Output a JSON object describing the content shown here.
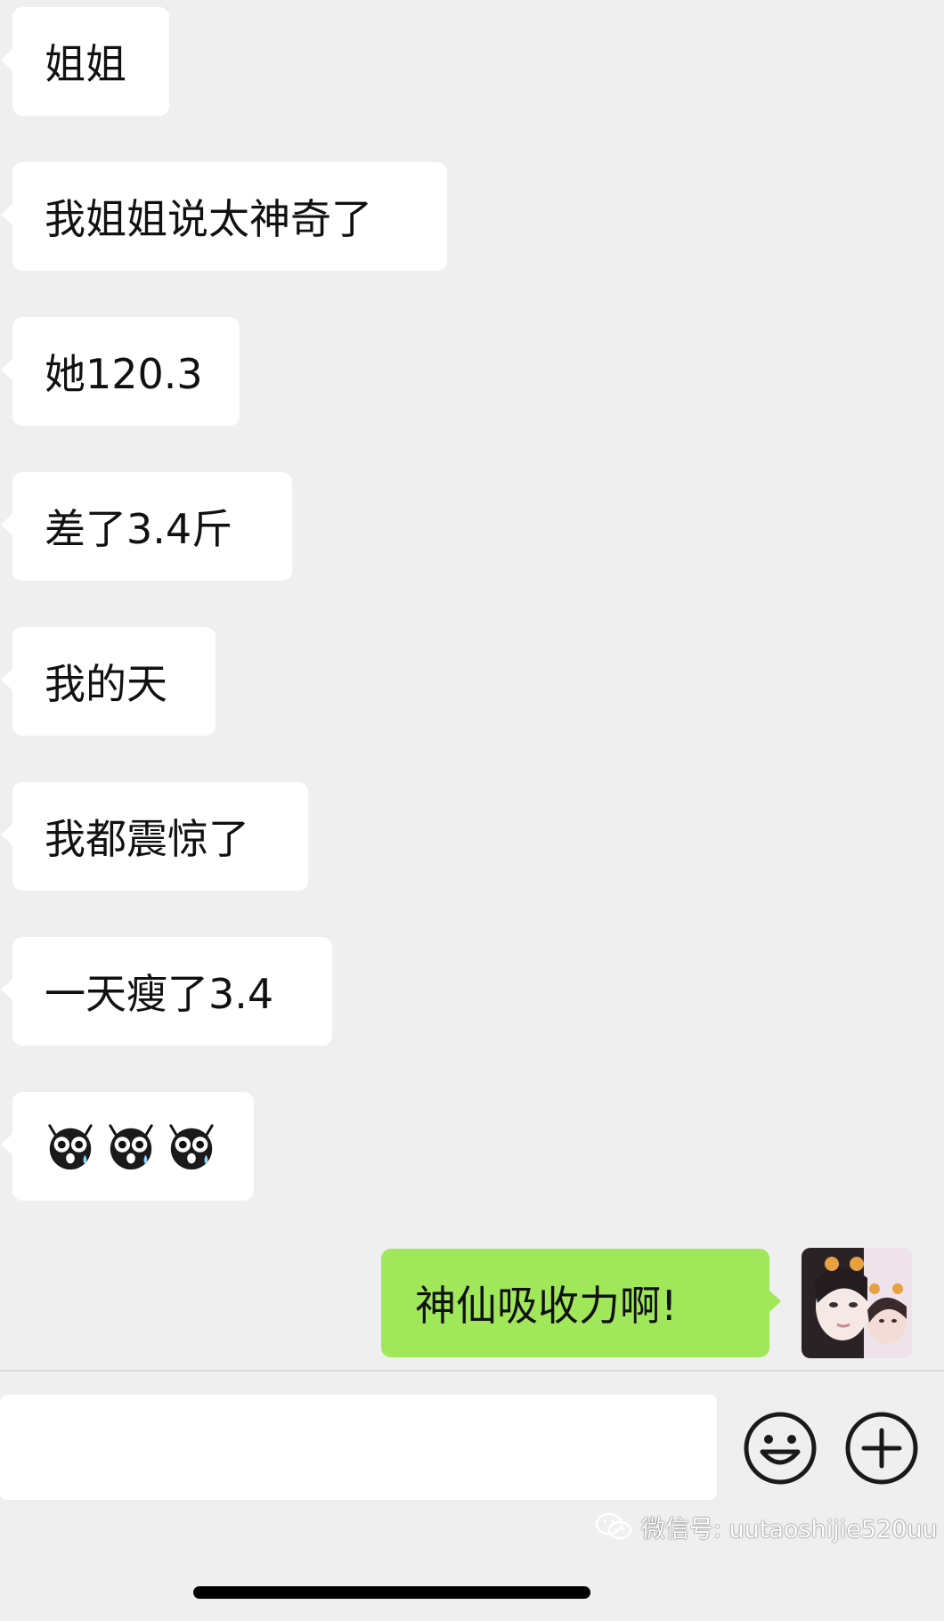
{
  "chat": {
    "received": [
      {
        "text": "姐姐"
      },
      {
        "text": "我姐姐说太神奇了"
      },
      {
        "text": "她120.3"
      },
      {
        "text": "差了3.4斤"
      },
      {
        "text": "我的天"
      },
      {
        "text": "我都震惊了"
      },
      {
        "text": "一天瘦了3.4"
      }
    ],
    "emoji_message": {
      "icons": [
        "shocked-owl-icon",
        "shocked-owl-icon",
        "shocked-owl-icon"
      ]
    },
    "sent": [
      {
        "text": "神仙吸收力啊!"
      }
    ]
  },
  "input_bar": {
    "value": "",
    "placeholder": "",
    "emoji_button_icon": "smiley-icon",
    "more_button_icon": "plus-circle-icon"
  },
  "watermark": {
    "text": "微信号: uutaoshijie520uu",
    "icon": "wechat-icon"
  },
  "colors": {
    "background": "#efefef",
    "received_bubble": "#ffffff",
    "sent_bubble": "#a0e75a",
    "text": "#111111",
    "home_indicator": "#000000"
  }
}
